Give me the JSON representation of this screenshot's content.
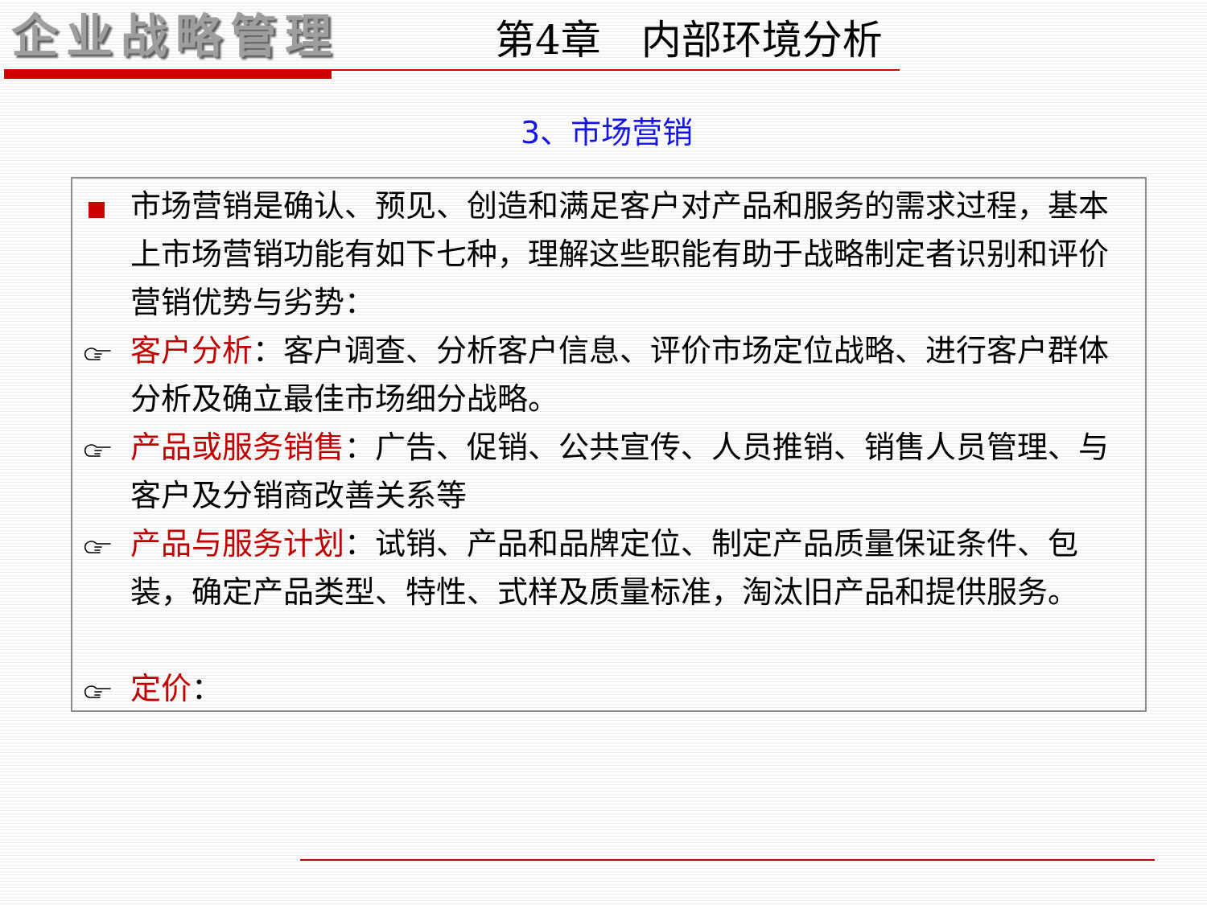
{
  "header": {
    "brand": "企业战略管理",
    "chapter": "第4章　内部环境分析"
  },
  "section": {
    "title": "3、市场营销"
  },
  "content": {
    "intro": "市场营销是确认、预见、创造和满足客户对产品和服务的需求过程，基本上市场营销功能有如下七种，理解这些职能有助于战略制定者识别和评价营销优势与劣势：",
    "items": [
      {
        "term": "客户分析",
        "sep": "：",
        "desc": "客户调查、分析客户信息、评价市场定位战略、进行客户群体分析及确立最佳市场细分战略。"
      },
      {
        "term": "产品或服务销售",
        "sep": "：",
        "desc": "广告、促销、公共宣传、人员推销、销售人员管理、与客户及分销商改善关系等"
      },
      {
        "term": "产品与服务计划",
        "sep": "：",
        "desc": "试销、产品和品牌定位、制定产品质量保证条件、包装，确定产品类型、特性、式样及质量标准，淘汰旧产品和提供服务。"
      },
      {
        "term": "定价",
        "sep": "：",
        "desc": ""
      }
    ]
  },
  "colors": {
    "accent_red": "#d00000",
    "term_red": "#c00000",
    "section_blue": "#1414e6",
    "brand_gray": "#9e9e9e"
  },
  "icons": {
    "intro_bullet": "red-square-bullet",
    "item_bullet": "pointing-hand-icon"
  }
}
